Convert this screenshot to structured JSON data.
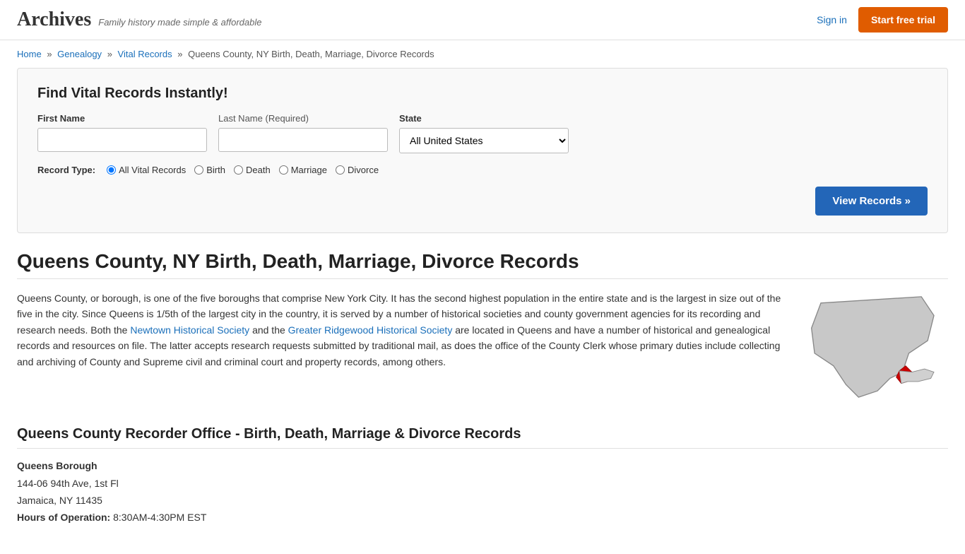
{
  "header": {
    "logo": "Archives",
    "tagline": "Family history made simple & affordable",
    "sign_in": "Sign in",
    "trial_button": "Start free trial"
  },
  "breadcrumb": {
    "home": "Home",
    "genealogy": "Genealogy",
    "vital_records": "Vital Records",
    "current": "Queens County, NY Birth, Death, Marriage, Divorce Records"
  },
  "search": {
    "title": "Find Vital Records Instantly!",
    "first_name_label": "First Name",
    "last_name_label": "Last Name",
    "last_name_required": "(Required)",
    "state_label": "State",
    "state_default": "All United States",
    "first_name_placeholder": "",
    "last_name_placeholder": "",
    "record_type_label": "Record Type:",
    "record_types": [
      {
        "id": "rt-all",
        "label": "All Vital Records",
        "checked": true
      },
      {
        "id": "rt-birth",
        "label": "Birth",
        "checked": false
      },
      {
        "id": "rt-death",
        "label": "Death",
        "checked": false
      },
      {
        "id": "rt-marriage",
        "label": "Marriage",
        "checked": false
      },
      {
        "id": "rt-divorce",
        "label": "Divorce",
        "checked": false
      }
    ],
    "view_button": "View Records »"
  },
  "page": {
    "title": "Queens County, NY Birth, Death, Marriage, Divorce Records",
    "description_1": "Queens County, or borough, is one of the five boroughs that comprise New York City. It has the second highest population in the entire state and is the largest in size out of the five in the city. Since Queens is 1/5th of the largest city in the country, it is served by a number of historical societies and county government agencies for its recording and research needs. Both the",
    "link1_text": "Newtown Historical Society",
    "description_2": "and the",
    "link2_text": "Greater Ridgewood Historical Society",
    "description_3": "are located in Queens and have a number of historical and genealogical records and resources on file. The latter accepts research requests submitted by traditional mail, as does the office of the County Clerk whose primary duties include collecting and archiving of County and Supreme civil and criminal court and property records, among others.",
    "recorder_title": "Queens County Recorder Office - Birth, Death, Marriage & Divorce Records",
    "office_name": "Queens Borough",
    "address_line1": "144-06 94th Ave, 1st Fl",
    "address_line2": "Jamaica, NY 11435",
    "hours_label": "Hours of Operation:",
    "hours_value": "8:30AM-4:30PM EST"
  }
}
